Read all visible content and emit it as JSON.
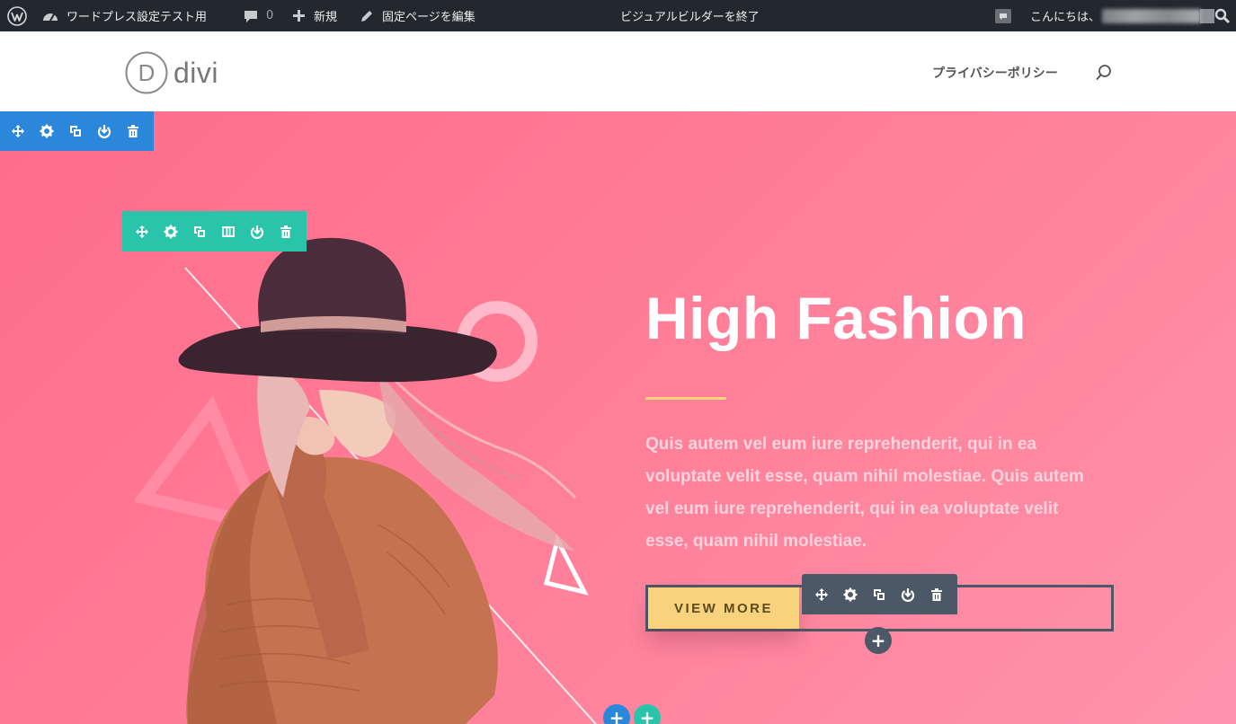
{
  "adminbar": {
    "wp_logo_icon": "wordpress-icon",
    "site_name": "ワードプレス設定テスト用",
    "comments_count": "0",
    "new_label": "新規",
    "edit_label": "固定ページを編集",
    "exit_builder_label": "ビジュアルビルダーを終了",
    "greeting": "こんにちは、"
  },
  "header": {
    "logo_letter": "D",
    "logo_text": "divi",
    "nav_link": "プライバシーポリシー"
  },
  "hero": {
    "headline": "High Fashion",
    "body": "Quis autem vel eum iure reprehenderit, qui in ea voluptate velit esse, quam nihil molestiae. Quis autem vel eum iure reprehenderit, qui in ea voluptate velit esse, quam nihil molestiae.",
    "button_label": "VIEW MORE"
  },
  "builder": {
    "add_symbol": "+",
    "section_toolbar_icons": [
      "move-icon",
      "settings-icon",
      "duplicate-icon",
      "save-icon",
      "delete-icon"
    ],
    "row_toolbar_icons": [
      "move-icon",
      "settings-icon",
      "duplicate-icon",
      "columns-icon",
      "save-icon",
      "delete-icon"
    ],
    "module_toolbar_icons": [
      "move-icon",
      "settings-icon",
      "duplicate-icon",
      "save-icon",
      "delete-icon"
    ]
  },
  "colors": {
    "adminbar_bg": "#23282d",
    "section_blue": "#2b87da",
    "row_teal": "#29c4a9",
    "module_gray": "#4c5866",
    "hero_pink": "#ff7e98",
    "accent_yellow": "#f8d27d"
  }
}
